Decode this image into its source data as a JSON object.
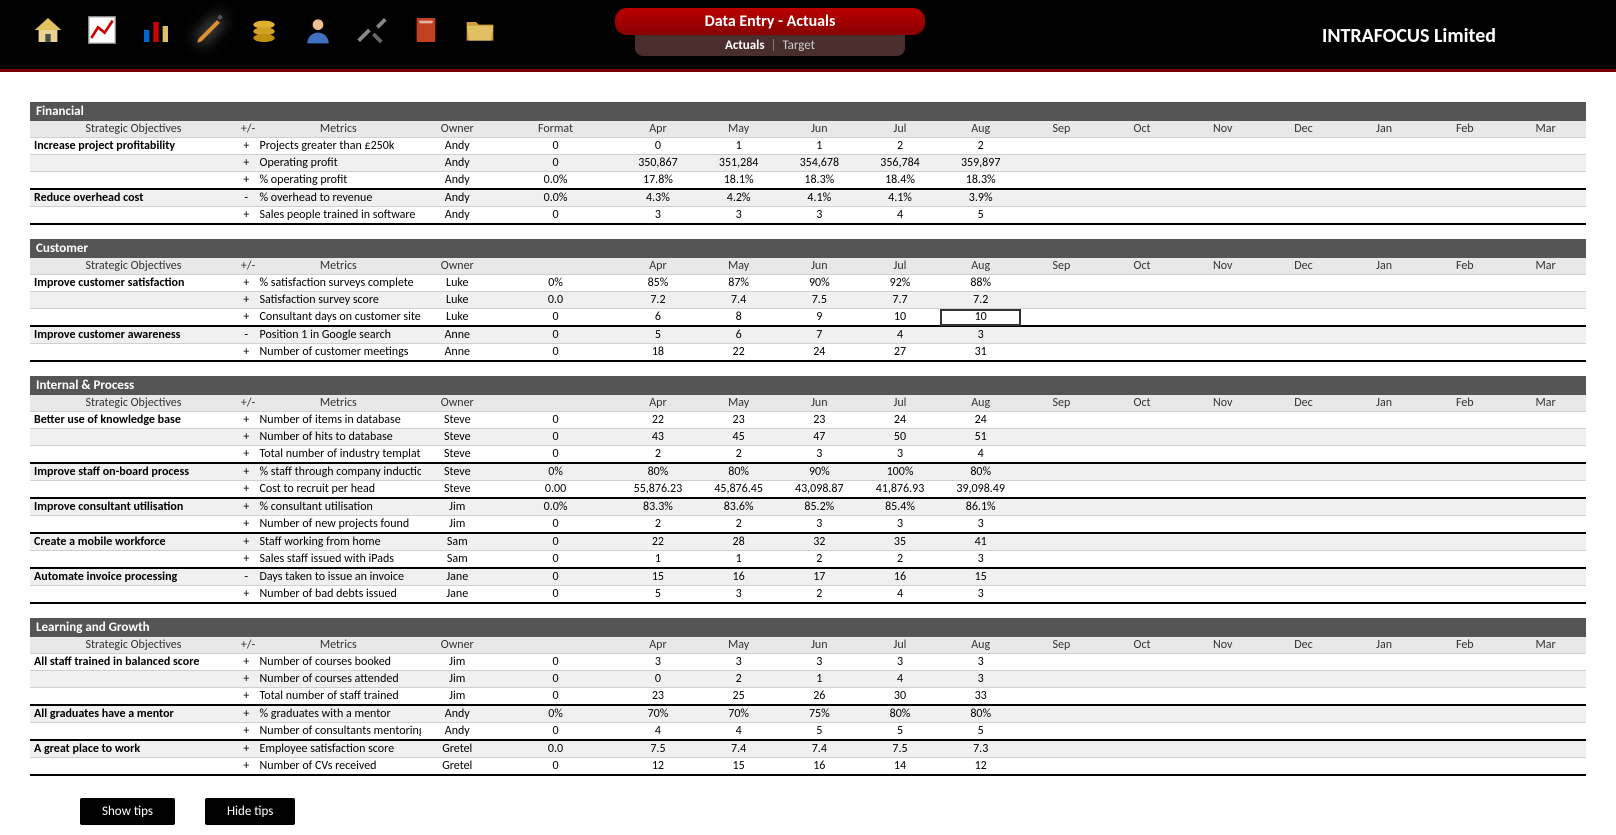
{
  "header": {
    "title": "Data Entry - Actuals",
    "tab_actuals": "Actuals",
    "tab_target": "Target",
    "company": "INTRAFOCUS Limited"
  },
  "months": [
    "Apr",
    "May",
    "Jun",
    "Jul",
    "Aug",
    "Sep",
    "Oct",
    "Nov",
    "Dec",
    "Jan",
    "Feb",
    "Mar"
  ],
  "col_headers": {
    "objectives": "Strategic Objectives",
    "pm": "+/-",
    "metrics": "Metrics",
    "owner": "Owner",
    "format": "Format"
  },
  "sections": [
    {
      "name": "Financial",
      "show_format": true,
      "rows": [
        {
          "obj": "Increase project profitability",
          "pm": "+",
          "metric": "Projects greater than £250k",
          "owner": "Andy",
          "fmt": "0",
          "vals": [
            "0",
            "1",
            "1",
            "2",
            "2",
            "",
            "",
            "",
            "",
            "",
            "",
            ""
          ]
        },
        {
          "obj": "",
          "pm": "+",
          "metric": "Operating profit",
          "owner": "Andy",
          "fmt": "0",
          "vals": [
            "350,867",
            "351,284",
            "354,678",
            "356,784",
            "359,897",
            "",
            "",
            "",
            "",
            "",
            "",
            ""
          ],
          "alt": true
        },
        {
          "obj": "",
          "pm": "+",
          "metric": "% operating profit",
          "owner": "Andy",
          "fmt": "0.0%",
          "vals": [
            "17.8%",
            "18.1%",
            "18.3%",
            "18.4%",
            "18.3%",
            "",
            "",
            "",
            "",
            "",
            "",
            ""
          ],
          "end": true
        },
        {
          "obj": "Reduce overhead cost",
          "pm": "-",
          "metric": "% overhead to revenue",
          "owner": "Andy",
          "fmt": "0.0%",
          "vals": [
            "4.3%",
            "4.2%",
            "4.1%",
            "4.1%",
            "3.9%",
            "",
            "",
            "",
            "",
            "",
            "",
            ""
          ],
          "alt": true
        },
        {
          "obj": "",
          "pm": "+",
          "metric": "Sales people trained in software",
          "owner": "Andy",
          "fmt": "0",
          "vals": [
            "3",
            "3",
            "3",
            "4",
            "5",
            "",
            "",
            "",
            "",
            "",
            "",
            ""
          ],
          "end": true
        }
      ]
    },
    {
      "name": "Customer",
      "show_format": false,
      "rows": [
        {
          "obj": "Improve customer satisfaction",
          "pm": "+",
          "metric": "% satisfaction surveys complete",
          "owner": "Luke",
          "fmt": "0%",
          "vals": [
            "85%",
            "87%",
            "90%",
            "92%",
            "88%",
            "",
            "",
            "",
            "",
            "",
            "",
            ""
          ]
        },
        {
          "obj": "",
          "pm": "+",
          "metric": "Satisfaction survey score",
          "owner": "Luke",
          "fmt": "0.0",
          "vals": [
            "7.2",
            "7.4",
            "7.5",
            "7.7",
            "7.2",
            "",
            "",
            "",
            "",
            "",
            "",
            ""
          ],
          "alt": true
        },
        {
          "obj": "",
          "pm": "+",
          "metric": "Consultant days on customer site",
          "owner": "Luke",
          "fmt": "0",
          "vals": [
            "6",
            "8",
            "9",
            "10",
            "10",
            "",
            "",
            "",
            "",
            "",
            "",
            ""
          ],
          "end": true,
          "selAug": true
        },
        {
          "obj": "Improve customer awareness",
          "pm": "-",
          "metric": "Position 1 in Google search",
          "owner": "Anne",
          "fmt": "0",
          "vals": [
            "5",
            "6",
            "7",
            "4",
            "3",
            "",
            "",
            "",
            "",
            "",
            "",
            ""
          ],
          "alt": true
        },
        {
          "obj": "",
          "pm": "+",
          "metric": "Number of customer meetings",
          "owner": "Anne",
          "fmt": "0",
          "vals": [
            "18",
            "22",
            "24",
            "27",
            "31",
            "",
            "",
            "",
            "",
            "",
            "",
            ""
          ],
          "end": true
        }
      ]
    },
    {
      "name": "Internal & Process",
      "show_format": false,
      "rows": [
        {
          "obj": "Better use of knowledge base",
          "pm": "+",
          "metric": "Number of items in database",
          "owner": "Steve",
          "fmt": "0",
          "vals": [
            "22",
            "23",
            "23",
            "24",
            "24",
            "",
            "",
            "",
            "",
            "",
            "",
            ""
          ]
        },
        {
          "obj": "",
          "pm": "+",
          "metric": "Number of hits to database",
          "owner": "Steve",
          "fmt": "0",
          "vals": [
            "43",
            "45",
            "47",
            "50",
            "51",
            "",
            "",
            "",
            "",
            "",
            "",
            ""
          ],
          "alt": true
        },
        {
          "obj": "",
          "pm": "+",
          "metric": "Total number of industry template",
          "owner": "Steve",
          "fmt": "0",
          "vals": [
            "2",
            "2",
            "3",
            "3",
            "4",
            "",
            "",
            "",
            "",
            "",
            "",
            ""
          ],
          "end": true
        },
        {
          "obj": "Improve staff on-board process",
          "pm": "+",
          "metric": "% staff through company inductio",
          "owner": "Steve",
          "fmt": "0%",
          "vals": [
            "80%",
            "80%",
            "90%",
            "100%",
            "80%",
            "",
            "",
            "",
            "",
            "",
            "",
            ""
          ],
          "alt": true
        },
        {
          "obj": "",
          "pm": "+",
          "metric": "Cost to recruit per head",
          "owner": "Steve",
          "fmt": "0.00",
          "vals": [
            "55,876.23",
            "45,876.45",
            "43,098.87",
            "41,876.93",
            "39,098.49",
            "",
            "",
            "",
            "",
            "",
            "",
            ""
          ],
          "end": true
        },
        {
          "obj": "Improve consultant utilisation",
          "pm": "+",
          "metric": "% consultant utilisation",
          "owner": "Jim",
          "fmt": "0.0%",
          "vals": [
            "83.3%",
            "83.6%",
            "85.2%",
            "85.4%",
            "86.1%",
            "",
            "",
            "",
            "",
            "",
            "",
            ""
          ],
          "alt": true
        },
        {
          "obj": "",
          "pm": "+",
          "metric": "Number of new projects found",
          "owner": "Jim",
          "fmt": "0",
          "vals": [
            "2",
            "2",
            "3",
            "3",
            "3",
            "",
            "",
            "",
            "",
            "",
            "",
            ""
          ],
          "end": true
        },
        {
          "obj": "Create a mobile workforce",
          "pm": "+",
          "metric": "Staff working from home",
          "owner": "Sam",
          "fmt": "0",
          "vals": [
            "22",
            "28",
            "32",
            "35",
            "41",
            "",
            "",
            "",
            "",
            "",
            "",
            ""
          ],
          "alt": true
        },
        {
          "obj": "",
          "pm": "+",
          "metric": "Sales staff issued with iPads",
          "owner": "Sam",
          "fmt": "0",
          "vals": [
            "1",
            "1",
            "2",
            "2",
            "3",
            "",
            "",
            "",
            "",
            "",
            "",
            ""
          ],
          "end": true
        },
        {
          "obj": "Automate invoice processing",
          "pm": "-",
          "metric": "Days taken to issue an invoice",
          "owner": "Jane",
          "fmt": "0",
          "vals": [
            "15",
            "16",
            "17",
            "16",
            "15",
            "",
            "",
            "",
            "",
            "",
            "",
            ""
          ],
          "alt": true
        },
        {
          "obj": "",
          "pm": "+",
          "metric": "Number of bad debts issued",
          "owner": "Jane",
          "fmt": "0",
          "vals": [
            "5",
            "3",
            "2",
            "4",
            "3",
            "",
            "",
            "",
            "",
            "",
            "",
            ""
          ],
          "end": true
        }
      ]
    },
    {
      "name": "Learning and Growth",
      "show_format": false,
      "rows": [
        {
          "obj": "All staff trained in balanced score",
          "pm": "+",
          "metric": "Number of courses booked",
          "owner": "Jim",
          "fmt": "0",
          "vals": [
            "3",
            "3",
            "3",
            "3",
            "3",
            "",
            "",
            "",
            "",
            "",
            "",
            ""
          ]
        },
        {
          "obj": "",
          "pm": "+",
          "metric": "Number of courses attended",
          "owner": "Jim",
          "fmt": "0",
          "vals": [
            "0",
            "2",
            "1",
            "4",
            "3",
            "",
            "",
            "",
            "",
            "",
            "",
            ""
          ],
          "alt": true
        },
        {
          "obj": "",
          "pm": "+",
          "metric": "Total number of staff trained",
          "owner": "Jim",
          "fmt": "0",
          "vals": [
            "23",
            "25",
            "26",
            "30",
            "33",
            "",
            "",
            "",
            "",
            "",
            "",
            ""
          ],
          "end": true
        },
        {
          "obj": "All graduates have a mentor",
          "pm": "+",
          "metric": "% graduates with a mentor",
          "owner": "Andy",
          "fmt": "0%",
          "vals": [
            "70%",
            "70%",
            "75%",
            "80%",
            "80%",
            "",
            "",
            "",
            "",
            "",
            "",
            ""
          ],
          "alt": true
        },
        {
          "obj": "",
          "pm": "+",
          "metric": "Number of consultants mentoring",
          "owner": "Andy",
          "fmt": "0",
          "vals": [
            "4",
            "4",
            "5",
            "5",
            "5",
            "",
            "",
            "",
            "",
            "",
            "",
            ""
          ],
          "end": true
        },
        {
          "obj": "A great place to work",
          "pm": "+",
          "metric": "Employee satisfaction score",
          "owner": "Gretel",
          "fmt": "0.0",
          "vals": [
            "7.5",
            "7.4",
            "7.4",
            "7.5",
            "7.3",
            "",
            "",
            "",
            "",
            "",
            "",
            ""
          ],
          "alt": true
        },
        {
          "obj": "",
          "pm": "+",
          "metric": "Number of CVs received",
          "owner": "Gretel",
          "fmt": "0",
          "vals": [
            "12",
            "15",
            "16",
            "14",
            "12",
            "",
            "",
            "",
            "",
            "",
            "",
            ""
          ],
          "end": true
        }
      ]
    }
  ],
  "buttons": {
    "show": "Show tips",
    "hide": "Hide tips"
  }
}
